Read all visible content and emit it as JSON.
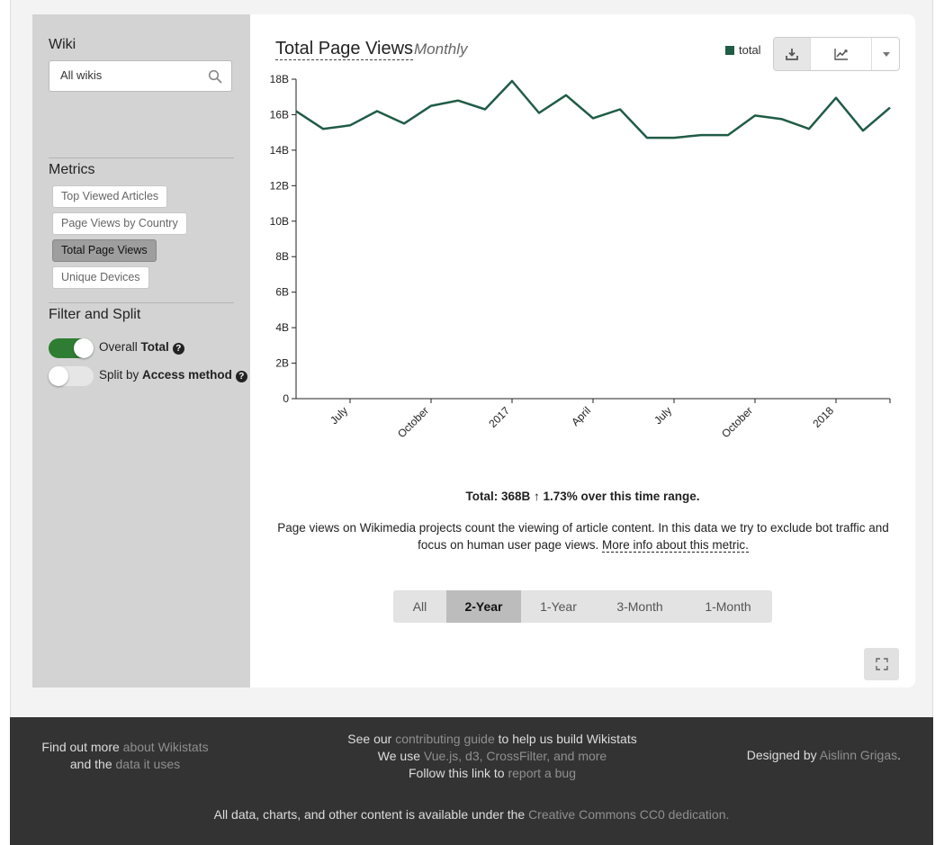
{
  "sidebar": {
    "wiki_heading": "Wiki",
    "wiki_search_value": "All wikis",
    "metrics_heading": "Metrics",
    "metrics": [
      {
        "label": "Top Viewed Articles",
        "active": false
      },
      {
        "label": "Page Views by Country",
        "active": false
      },
      {
        "label": "Total Page Views",
        "active": true
      },
      {
        "label": "Unique Devices",
        "active": false
      }
    ],
    "filter_heading": "Filter and Split",
    "toggles": [
      {
        "prefix": "Overall",
        "bold": "Total",
        "on": true
      },
      {
        "prefix": "Split by",
        "bold": "Access method",
        "on": false
      }
    ]
  },
  "main": {
    "title": "Total Page Views",
    "subtitle": "Monthly",
    "legend_label": "total",
    "summary": "Total: 368B ↑ 1.73% over this time range.",
    "description": "Page views on Wikimedia projects count the viewing of article content. In this data we try to exclude bot traffic and focus on human user page views.",
    "more_info_link": "More info about this metric.",
    "ranges": [
      {
        "label": "All",
        "active": false
      },
      {
        "label": "2-Year",
        "active": true
      },
      {
        "label": "1-Year",
        "active": false
      },
      {
        "label": "3-Month",
        "active": false
      },
      {
        "label": "1-Month",
        "active": false
      }
    ]
  },
  "colors": {
    "series": "#1f5c45",
    "toggle_on": "#2e7d32",
    "toggle_off": "#e6e6e6"
  },
  "chart_data": {
    "type": "line",
    "title": "Total Page Views",
    "subtitle": "Monthly",
    "x_tick_labels": [
      "July",
      "October",
      "2017",
      "April",
      "July",
      "October",
      "2018"
    ],
    "y_tick_labels": [
      "0",
      "2B",
      "4B",
      "6B",
      "8B",
      "10B",
      "12B",
      "14B",
      "16B",
      "18B"
    ],
    "ylim": [
      0,
      18
    ],
    "y_unit": "B",
    "series": [
      {
        "name": "total",
        "x": [
          "2016-05",
          "2016-06",
          "2016-07",
          "2016-08",
          "2016-09",
          "2016-10",
          "2016-11",
          "2016-12",
          "2017-01",
          "2017-02",
          "2017-03",
          "2017-04",
          "2017-05",
          "2017-06",
          "2017-07",
          "2017-08",
          "2017-09",
          "2017-10",
          "2017-11",
          "2017-12",
          "2018-01",
          "2018-02",
          "2018-03"
        ],
        "values": [
          16.2,
          15.2,
          15.4,
          16.2,
          15.5,
          16.5,
          16.8,
          16.3,
          17.9,
          16.1,
          17.1,
          15.8,
          16.3,
          14.7,
          14.7,
          14.85,
          14.85,
          15.95,
          15.75,
          15.2,
          16.95,
          15.1,
          16.4
        ]
      }
    ]
  },
  "footer": {
    "left_prefix_1": "Find out more",
    "left_link_1": "about Wikistats",
    "left_prefix_2": "and the",
    "left_link_2": "data it uses",
    "mid_prefix_1": "See our",
    "mid_link_1": "contributing guide",
    "mid_suffix_1": "to help us build Wikistats",
    "mid_prefix_2": "We use",
    "mid_link_2": "Vue.js, d3, CrossFilter, and more",
    "mid_prefix_3": "Follow this link to",
    "mid_link_3": "report a bug",
    "right_prefix": "Designed by",
    "right_link": "Aislinn Grigas",
    "right_suffix": ".",
    "bottom_prefix": "All data, charts, and other content is available under the",
    "bottom_link": "Creative Commons CC0 dedication",
    "bottom_suffix": "."
  }
}
